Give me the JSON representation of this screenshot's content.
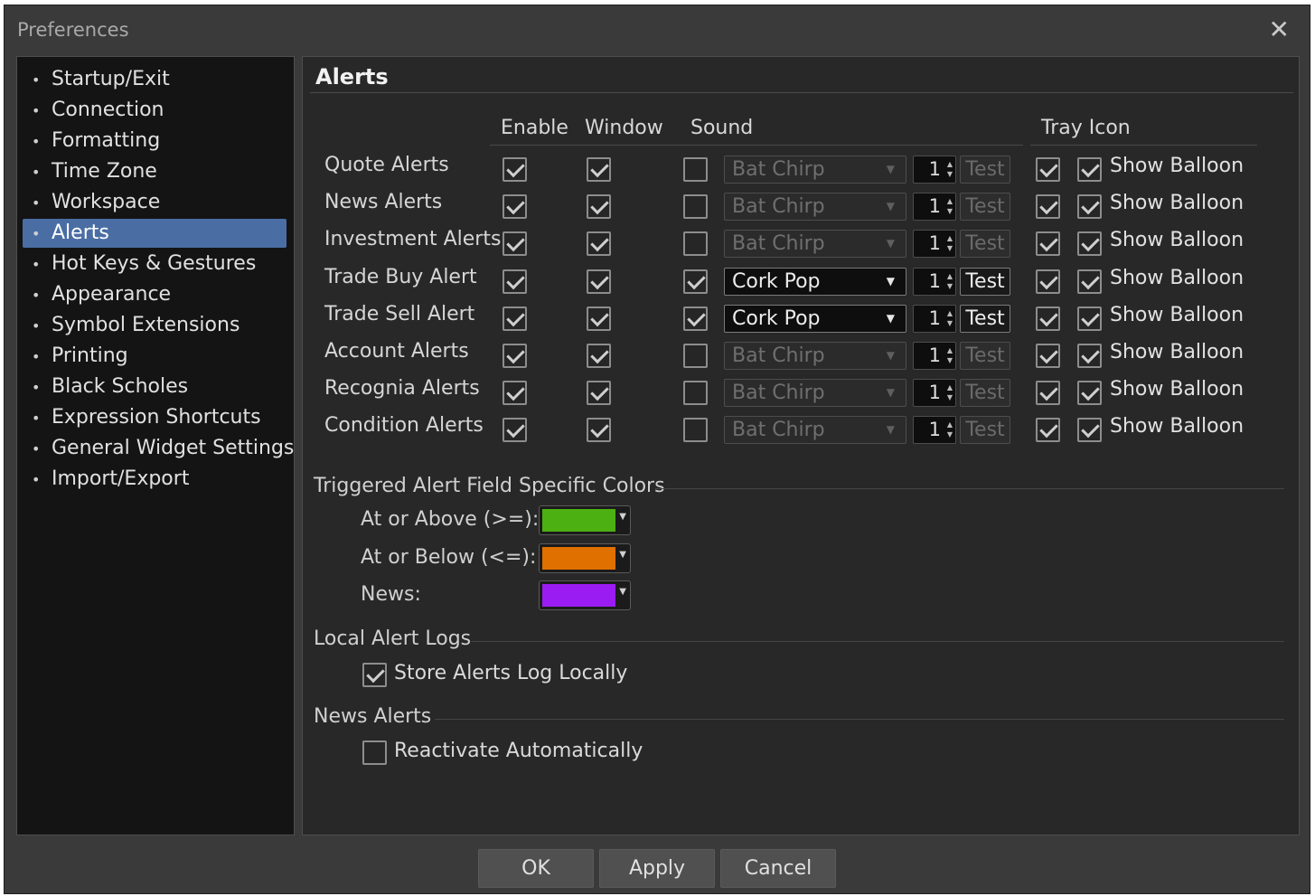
{
  "window": {
    "title": "Preferences",
    "close_glyph": "✕"
  },
  "sidebar": {
    "items": [
      {
        "label": "Startup/Exit",
        "active": false
      },
      {
        "label": "Connection",
        "active": false
      },
      {
        "label": "Formatting",
        "active": false
      },
      {
        "label": "Time Zone",
        "active": false
      },
      {
        "label": "Workspace",
        "active": false
      },
      {
        "label": "Alerts",
        "active": true
      },
      {
        "label": "Hot Keys & Gestures",
        "active": false
      },
      {
        "label": "Appearance",
        "active": false
      },
      {
        "label": "Symbol Extensions",
        "active": false
      },
      {
        "label": "Printing",
        "active": false
      },
      {
        "label": "Black Scholes",
        "active": false
      },
      {
        "label": "Expression Shortcuts",
        "active": false
      },
      {
        "label": "General Widget Settings",
        "active": false
      },
      {
        "label": "Import/Export",
        "active": false
      }
    ]
  },
  "panel": {
    "title": "Alerts",
    "columns": {
      "enable": "Enable",
      "window": "Window",
      "sound": "Sound",
      "tray_icon": "Tray Icon"
    },
    "rows": [
      {
        "label": "Quote Alerts",
        "enable": true,
        "window": true,
        "sound": false,
        "sound_name": "Bat Chirp",
        "count": "1",
        "test": "Test",
        "tray": true,
        "balloon": true,
        "balloon_label": "Show Balloon"
      },
      {
        "label": "News Alerts",
        "enable": true,
        "window": true,
        "sound": false,
        "sound_name": "Bat Chirp",
        "count": "1",
        "test": "Test",
        "tray": true,
        "balloon": true,
        "balloon_label": "Show Balloon"
      },
      {
        "label": "Investment Alerts",
        "enable": true,
        "window": true,
        "sound": false,
        "sound_name": "Bat Chirp",
        "count": "1",
        "test": "Test",
        "tray": true,
        "balloon": true,
        "balloon_label": "Show Balloon"
      },
      {
        "label": "Trade Buy Alert",
        "enable": true,
        "window": true,
        "sound": true,
        "sound_name": "Cork Pop",
        "count": "1",
        "test": "Test",
        "tray": true,
        "balloon": true,
        "balloon_label": "Show Balloon"
      },
      {
        "label": "Trade Sell Alert",
        "enable": true,
        "window": true,
        "sound": true,
        "sound_name": "Cork Pop",
        "count": "1",
        "test": "Test",
        "tray": true,
        "balloon": true,
        "balloon_label": "Show Balloon"
      },
      {
        "label": "Account Alerts",
        "enable": true,
        "window": true,
        "sound": false,
        "sound_name": "Bat Chirp",
        "count": "1",
        "test": "Test",
        "tray": true,
        "balloon": true,
        "balloon_label": "Show Balloon"
      },
      {
        "label": "Recognia Alerts",
        "enable": true,
        "window": true,
        "sound": false,
        "sound_name": "Bat Chirp",
        "count": "1",
        "test": "Test",
        "tray": true,
        "balloon": true,
        "balloon_label": "Show Balloon"
      },
      {
        "label": "Condition Alerts",
        "enable": true,
        "window": true,
        "sound": false,
        "sound_name": "Bat Chirp",
        "count": "1",
        "test": "Test",
        "tray": true,
        "balloon": true,
        "balloon_label": "Show Balloon"
      }
    ],
    "colors_section": {
      "title": "Triggered Alert Field Specific Colors",
      "items": [
        {
          "label": "At or Above (>=):",
          "color": "#4caf12"
        },
        {
          "label": "At or Below (<=):",
          "color": "#e07000"
        },
        {
          "label": "News:",
          "color": "#9b1cf2"
        }
      ]
    },
    "logs_section": {
      "title": "Local Alert Logs",
      "store_label": "Store Alerts Log Locally",
      "store_checked": true
    },
    "news_section": {
      "title": "News Alerts",
      "reactivate_label": "Reactivate Automatically",
      "reactivate_checked": false
    }
  },
  "buttons": {
    "ok": "OK",
    "apply": "Apply",
    "cancel": "Cancel"
  }
}
